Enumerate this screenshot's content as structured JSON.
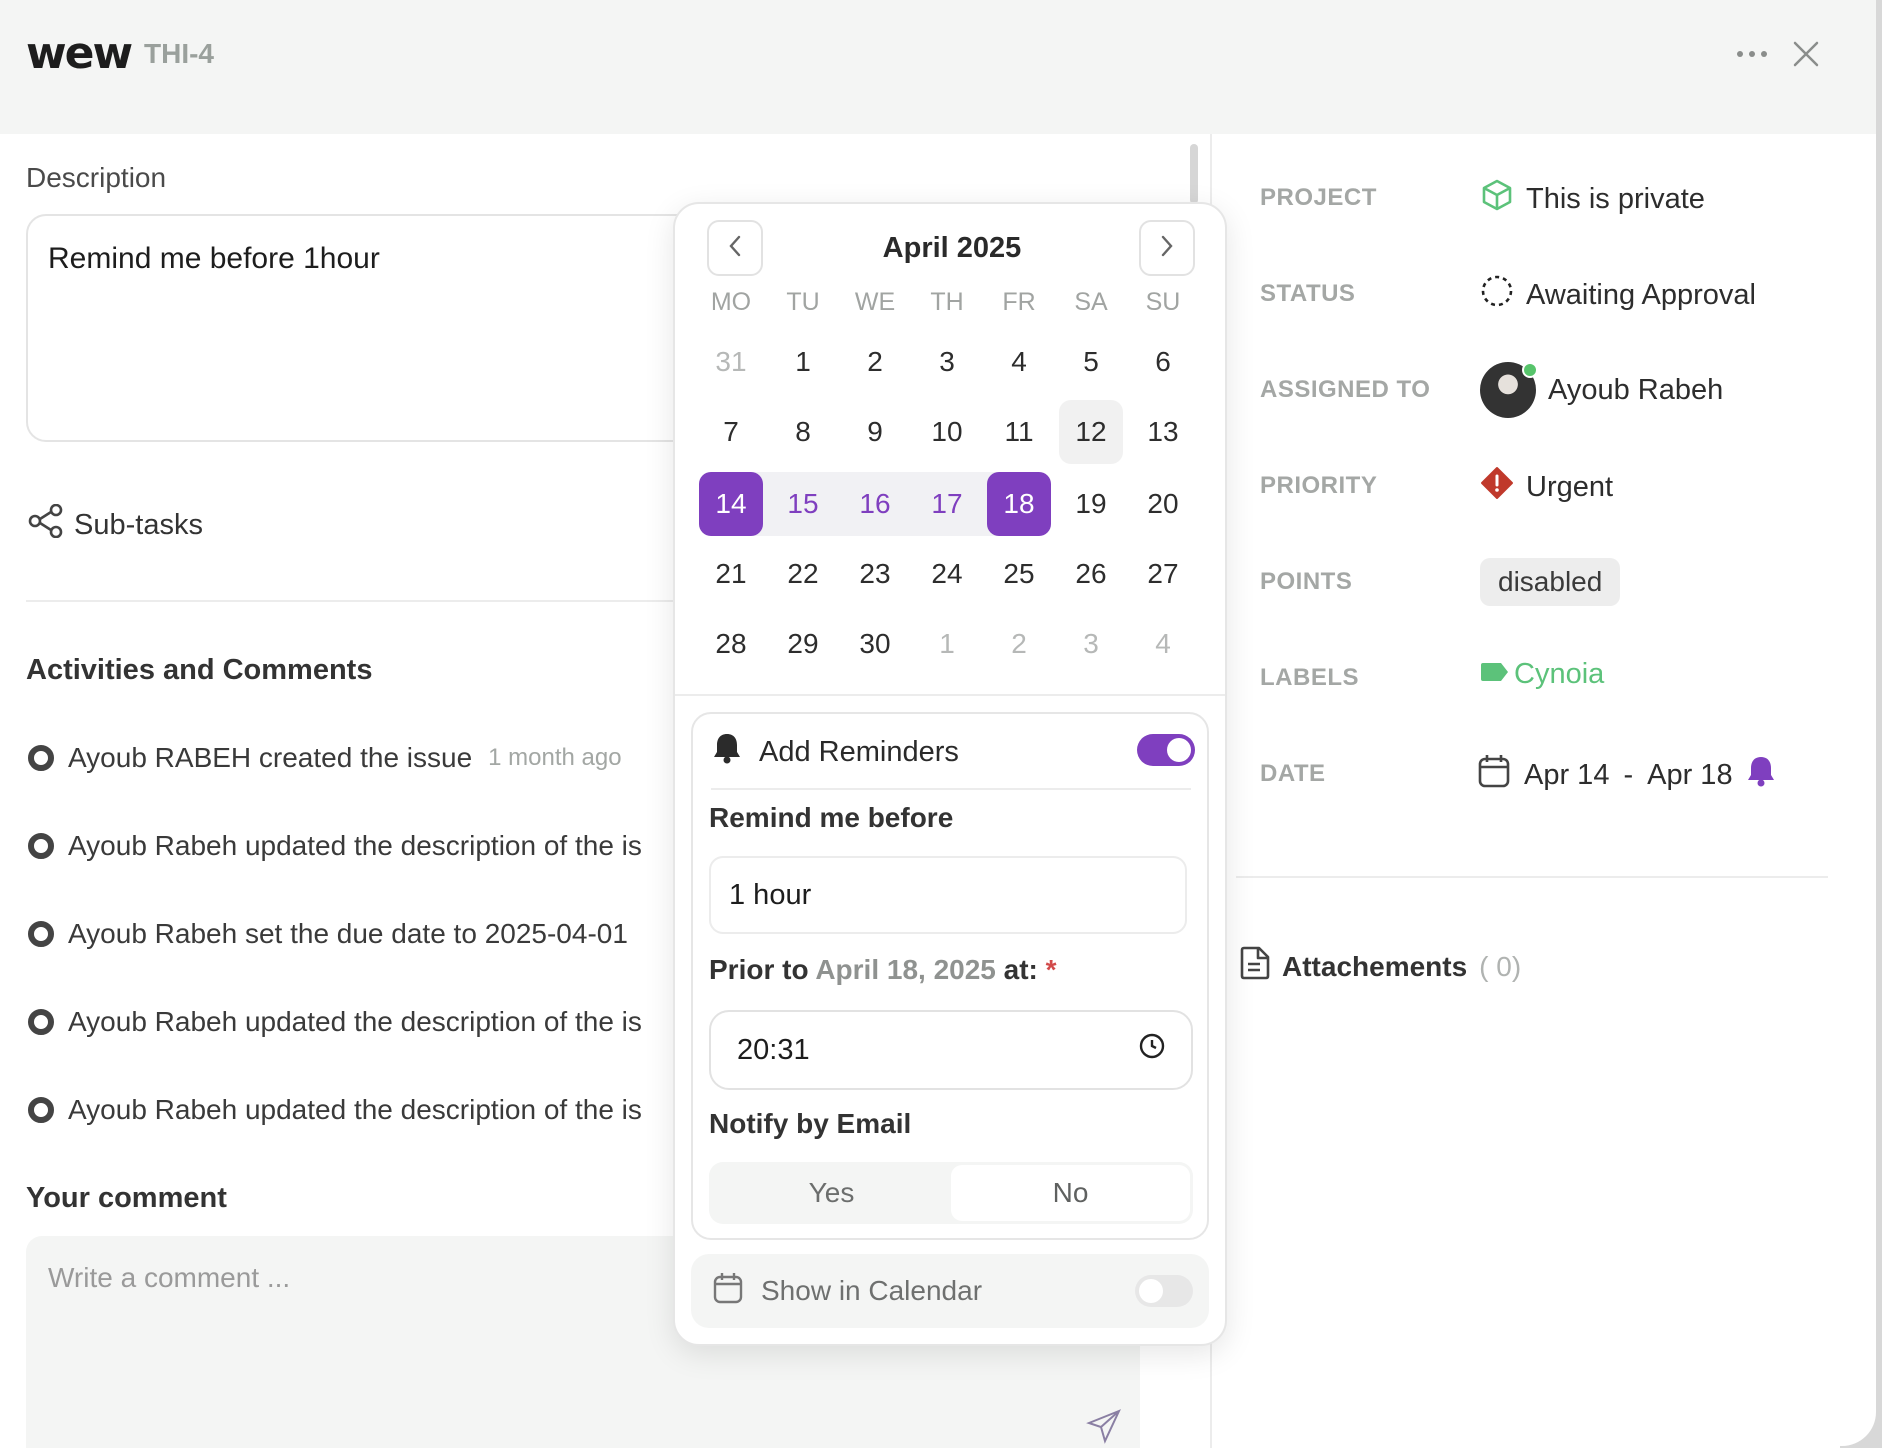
{
  "header": {
    "logo": "wew",
    "issue_id": "THI-4"
  },
  "description": {
    "label": "Description",
    "text": "Remind me before 1hour"
  },
  "subtasks": {
    "label": "Sub-tasks"
  },
  "activities": {
    "title": "Activities and Comments",
    "items": [
      {
        "text": "Ayoub RABEH created the issue",
        "time": "1 month ago"
      },
      {
        "text": "Ayoub Rabeh updated the description of the is",
        "time": ""
      },
      {
        "text": "Ayoub Rabeh set the due date to 2025-04-01",
        "time": ""
      },
      {
        "text": "Ayoub Rabeh updated the description of the is",
        "time": ""
      },
      {
        "text": "Ayoub Rabeh updated the description of the is",
        "time": ""
      }
    ]
  },
  "comment": {
    "title": "Your comment",
    "placeholder": "Write a comment ..."
  },
  "properties": {
    "project": {
      "label": "PROJECT",
      "value": "This is private"
    },
    "status": {
      "label": "STATUS",
      "value": "Awaiting Approval"
    },
    "assigned_to": {
      "label": "ASSIGNED TO",
      "value": "Ayoub Rabeh"
    },
    "priority": {
      "label": "PRIORITY",
      "value": "Urgent"
    },
    "points": {
      "label": "POINTS",
      "value": "disabled"
    },
    "labels": {
      "label": "LABELS",
      "value": "Cynoia"
    },
    "date": {
      "label": "DATE",
      "start": "Apr 14",
      "separator": "-",
      "end": "Apr 18"
    }
  },
  "attachments": {
    "label": "Attachements",
    "count": "( 0)"
  },
  "calendar": {
    "title": "April 2025",
    "weekdays": [
      "MO",
      "TU",
      "WE",
      "TH",
      "FR",
      "SA",
      "SU"
    ],
    "weeks": [
      [
        "31",
        "1",
        "2",
        "3",
        "4",
        "5",
        "6"
      ],
      [
        "7",
        "8",
        "9",
        "10",
        "11",
        "12",
        "13"
      ],
      [
        "14",
        "15",
        "16",
        "17",
        "18",
        "19",
        "20"
      ],
      [
        "21",
        "22",
        "23",
        "24",
        "25",
        "26",
        "27"
      ],
      [
        "28",
        "29",
        "30",
        "1",
        "2",
        "3",
        "4"
      ]
    ]
  },
  "reminder": {
    "title": "Add Reminders",
    "enabled": true,
    "remind_before_label": "Remind me before",
    "remind_before_value": "1 hour",
    "prior_to_prefix": "Prior to",
    "prior_to_date": "April 18, 2025",
    "prior_to_suffix": "at:",
    "required_mark": "*",
    "time": "20:31",
    "notify_label": "Notify by Email",
    "notify_yes": "Yes",
    "notify_no": "No",
    "notify_selected": "No"
  },
  "show_in_calendar": {
    "label": "Show in Calendar",
    "enabled": false
  },
  "colors": {
    "accent": "#7f3fbf",
    "green": "#5cc27a",
    "urgent": "#c0392b"
  }
}
